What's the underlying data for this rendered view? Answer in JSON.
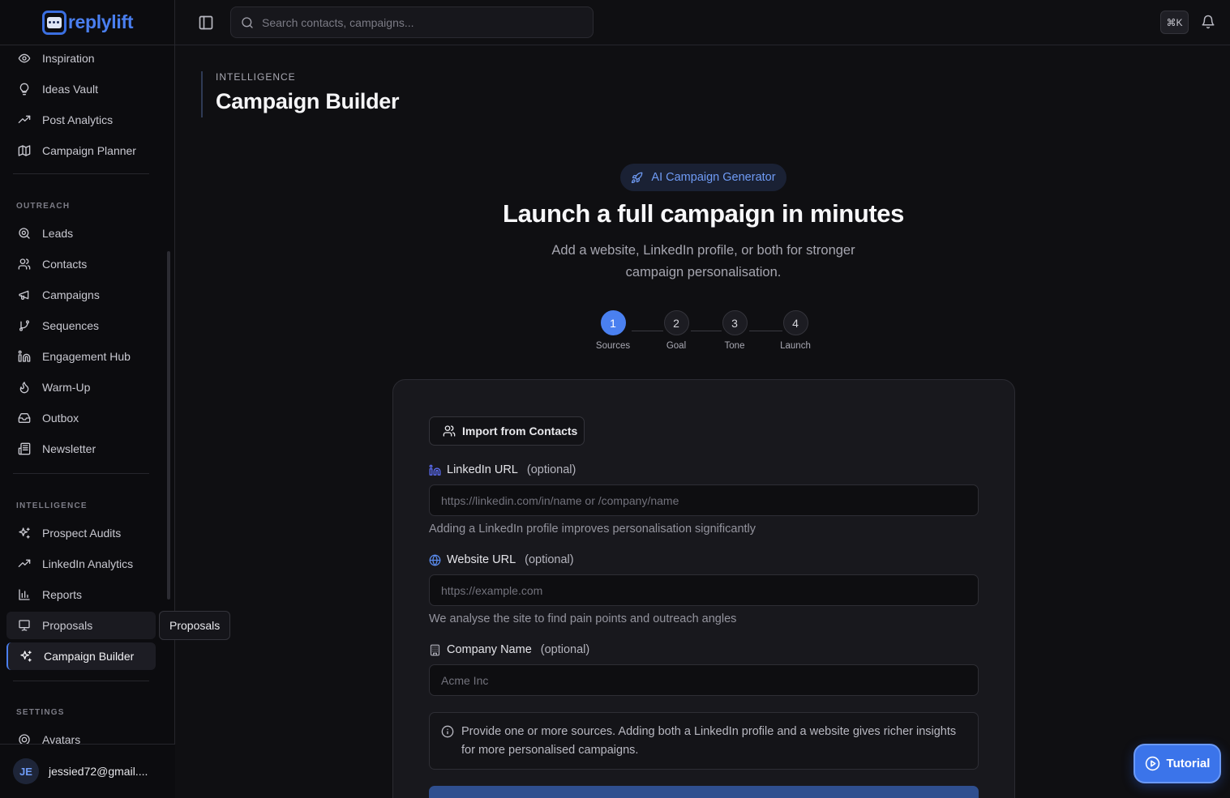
{
  "brand": {
    "name": "replylift",
    "accent": "#4a7ff0"
  },
  "topbar": {
    "search_placeholder": "Search contacts, campaigns...",
    "shortcut": "⌘K"
  },
  "sidebar": {
    "items_top": [
      {
        "label": "Inspiration",
        "icon": "eye-icon"
      },
      {
        "label": "Ideas Vault",
        "icon": "lightbulb-icon"
      },
      {
        "label": "Post Analytics",
        "icon": "trending-up-icon"
      },
      {
        "label": "Campaign Planner",
        "icon": "map-icon"
      }
    ],
    "outreach_label": "OUTREACH",
    "outreach_items": [
      {
        "label": "Leads",
        "icon": "search-icon"
      },
      {
        "label": "Contacts",
        "icon": "users-icon"
      },
      {
        "label": "Campaigns",
        "icon": "megaphone-icon"
      },
      {
        "label": "Sequences",
        "icon": "git-branch-icon"
      },
      {
        "label": "Engagement Hub",
        "icon": "linkedin-icon"
      },
      {
        "label": "Warm-Up",
        "icon": "flame-icon"
      },
      {
        "label": "Outbox",
        "icon": "inbox-icon"
      },
      {
        "label": "Newsletter",
        "icon": "newspaper-icon"
      }
    ],
    "intelligence_label": "INTELLIGENCE",
    "intelligence_items": [
      {
        "label": "Prospect Audits",
        "icon": "sparkles-icon"
      },
      {
        "label": "LinkedIn Analytics",
        "icon": "trending-up-icon"
      },
      {
        "label": "Reports",
        "icon": "bar-chart-icon"
      },
      {
        "label": "Proposals",
        "icon": "presentation-icon"
      },
      {
        "label": "Campaign Builder",
        "icon": "sparkles-icon"
      }
    ],
    "settings_label": "SETTINGS",
    "settings_items": [
      {
        "label": "Avatars",
        "icon": "avatar-icon"
      }
    ],
    "tooltip": "Proposals",
    "user": {
      "initials": "JE",
      "email": "jessied72@gmail...."
    }
  },
  "page": {
    "eyebrow": "INTELLIGENCE",
    "title": "Campaign Builder"
  },
  "hero": {
    "badge": "AI Campaign Generator",
    "title": "Launch a full campaign in minutes",
    "subtitle": "Add a website, LinkedIn profile, or both for stronger campaign personalisation."
  },
  "stepper": {
    "current": 1,
    "steps": [
      {
        "number": "1",
        "label": "Sources"
      },
      {
        "number": "2",
        "label": "Goal"
      },
      {
        "number": "3",
        "label": "Tone"
      },
      {
        "number": "4",
        "label": "Launch"
      }
    ]
  },
  "form": {
    "import_label": "Import from Contacts",
    "linkedin": {
      "label": "LinkedIn URL",
      "optional": "(optional)",
      "placeholder": "https://linkedin.com/in/name or /company/name",
      "value": "",
      "help": "Adding a LinkedIn profile improves personalisation significantly"
    },
    "website": {
      "label": "Website URL",
      "optional": "(optional)",
      "placeholder": "https://example.com",
      "value": "",
      "help": "We analyse the site to find pain points and outreach angles"
    },
    "company": {
      "label": "Company Name",
      "optional": "(optional)",
      "placeholder": "Acme Inc",
      "value": ""
    },
    "info": "Provide one or more sources. Adding both a LinkedIn profile and a website gives richer insights for more personalised campaigns."
  },
  "tutorial_label": "Tutorial"
}
